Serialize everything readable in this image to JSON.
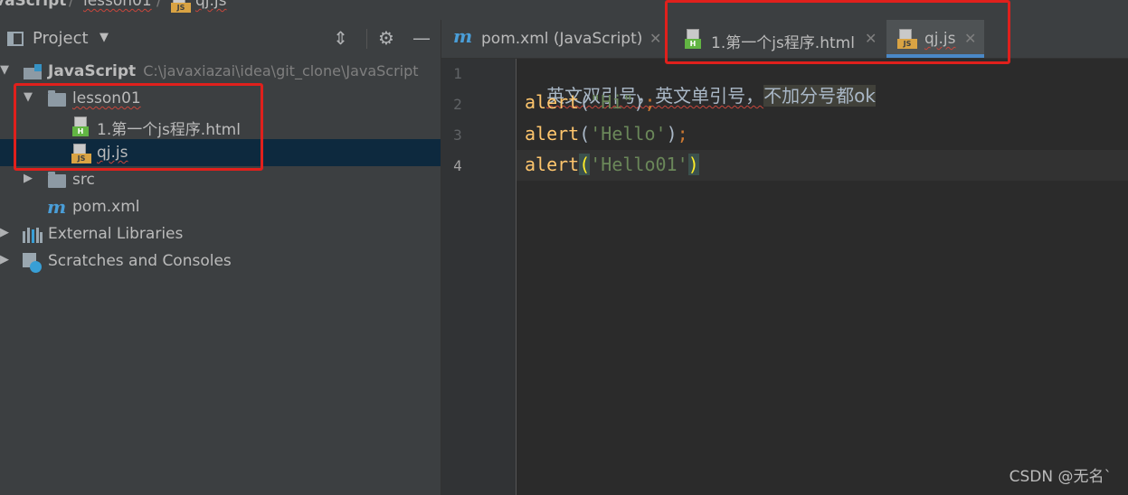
{
  "breadcrumb": {
    "items": [
      "vaScript",
      "lesson01",
      "qj.js"
    ]
  },
  "project_panel": {
    "title": "Project",
    "dropdown": "▼",
    "collapse_label": "⏷",
    "settings_icon": "gear-icon",
    "hide_icon": "minus-icon",
    "tree": [
      {
        "label": "JavaScript",
        "path": "C:\\javaxiazai\\idea\\git_clone\\JavaScript"
      },
      {
        "label": "lesson01"
      },
      {
        "label": "1.第一个js程序.html"
      },
      {
        "label": "qj.js"
      },
      {
        "label": "src"
      },
      {
        "label": "pom.xml"
      },
      {
        "label": "External Libraries"
      },
      {
        "label": "Scratches and Consoles"
      }
    ]
  },
  "tabs": [
    {
      "label": "pom.xml (JavaScript)",
      "icon": "maven-icon"
    },
    {
      "label": "1.第一个js程序.html",
      "icon": "html-file-icon"
    },
    {
      "label": "qj.js",
      "icon": "js-file-icon",
      "active": true
    }
  ],
  "editor": {
    "line_numbers": [
      "1",
      "2",
      "3",
      "4"
    ],
    "comment_line": "英文双引号，英文单引号，",
    "comment_highlight": "不加分号都ok",
    "lines": [
      {
        "fn": "alert",
        "open": "(",
        "arg": "\"Hi\"",
        "close": ")",
        "semi": ";"
      },
      {
        "fn": "alert",
        "open": "(",
        "arg": "'Hello'",
        "close": ")",
        "semi": ";"
      },
      {
        "fn": "alert",
        "open": "(",
        "arg": "'Hello01'",
        "close": ")",
        "semi": ""
      }
    ]
  },
  "watermark": "CSDN @无名`",
  "colors": {
    "annotation_box": "#e0201c",
    "active_tab_underline": "#4a88c7",
    "function_name": "#ffc66d",
    "string": "#6a8759"
  }
}
